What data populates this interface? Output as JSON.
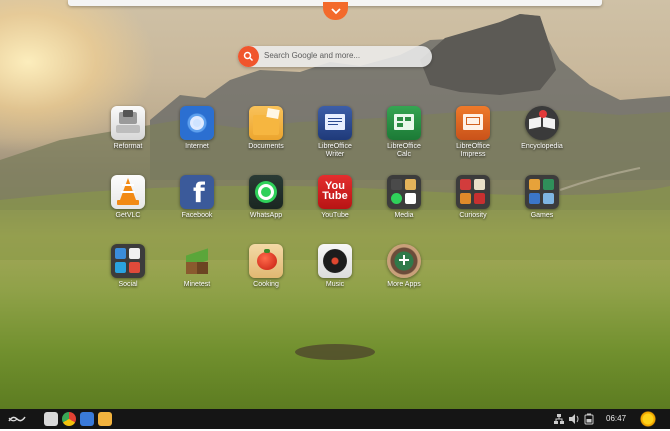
{
  "search": {
    "placeholder": "Search Google and more..."
  },
  "apps": [
    {
      "label": "Reformat",
      "icon": "reformat-icon"
    },
    {
      "label": "Internet",
      "icon": "chromium-icon"
    },
    {
      "label": "Documents",
      "icon": "folder-icon"
    },
    {
      "label": "LibreOffice Writer",
      "line1": "LibreOffice",
      "line2": "Writer",
      "icon": "writer-icon"
    },
    {
      "label": "LibreOffice Calc",
      "line1": "LibreOffice",
      "line2": "Calc",
      "icon": "calc-icon"
    },
    {
      "label": "LibreOffice Impress",
      "line1": "LibreOffice",
      "line2": "Impress",
      "icon": "impress-icon"
    },
    {
      "label": "Encyclopedia",
      "icon": "encyclopedia-icon"
    },
    {
      "label": "GetVLC",
      "icon": "vlc-icon"
    },
    {
      "label": "Facebook",
      "icon": "facebook-icon"
    },
    {
      "label": "WhatsApp",
      "icon": "whatsapp-icon"
    },
    {
      "label": "YouTube",
      "icon": "youtube-icon"
    },
    {
      "label": "Media",
      "icon": "media-folder-icon"
    },
    {
      "label": "Curiosity",
      "icon": "curiosity-folder-icon"
    },
    {
      "label": "Games",
      "icon": "games-folder-icon"
    },
    {
      "label": "Social",
      "icon": "social-folder-icon"
    },
    {
      "label": "Minetest",
      "icon": "minetest-icon"
    },
    {
      "label": "Cooking",
      "icon": "cooking-icon"
    },
    {
      "label": "Music",
      "icon": "music-icon"
    },
    {
      "label": "More Apps",
      "icon": "app-store-icon"
    }
  ],
  "youtube_logo": {
    "you": "You",
    "tube": "Tube"
  },
  "facebook_logo": "f",
  "taskbar": {
    "clock": "06:47",
    "items": [
      "show-desktop-icon",
      "files-icon",
      "chrome-icon",
      "browser-icon",
      "folder-icon"
    ]
  },
  "colors": {
    "accent": "#f36a2b",
    "taskbar": "#151515"
  }
}
